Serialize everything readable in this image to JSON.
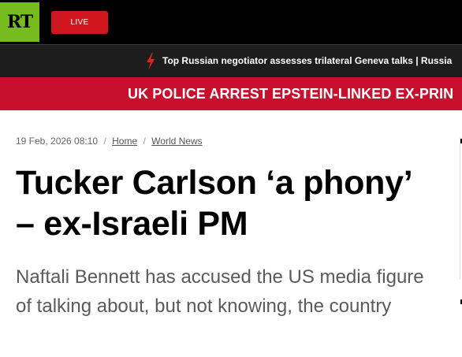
{
  "header": {
    "logo_text": "RT",
    "live_label": "LIVE",
    "brand_color": "#77bc1f",
    "live_color": "#d0161e"
  },
  "ticker": {
    "icon": "lightning-bolt-icon",
    "text": "Top Russian negotiator assesses trilateral Geneva talks | Russia"
  },
  "breaking": {
    "text": "UK POLICE ARREST EPSTEIN-LINKED EX-PRIN",
    "color": "#c8102e"
  },
  "article": {
    "date": "19 Feb, 2026 08:10",
    "breadcrumbs": [
      {
        "label": "Home"
      },
      {
        "label": "World News"
      }
    ],
    "headline_line1": "Tucker Carlson ‘a phony’",
    "headline_line2": "– ex-Israeli PM",
    "summary": "Naftali Bennett has accused the US media figure of talking about, but not knowing, the country"
  }
}
